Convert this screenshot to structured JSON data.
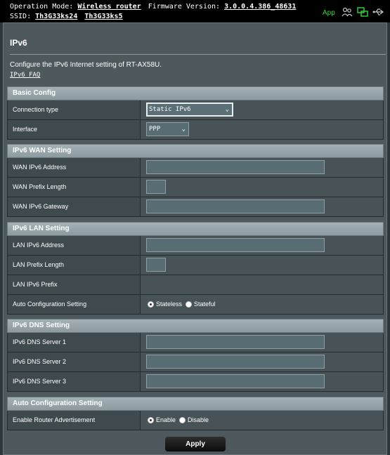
{
  "topbar": {
    "operation_mode_label": "Operation Mode:",
    "operation_mode_value": "Wireless router",
    "firmware_label": "Firmware Version:",
    "firmware_value": "3.0.0.4.386_48631",
    "ssid_label": "SSID:",
    "ssid_1": "Th3G33ks24",
    "ssid_2": "Th3G33ks5",
    "app_label": "App",
    "icons": [
      "users-icon",
      "network-status-icon",
      "usb-icon"
    ],
    "accent_color": "#33d633"
  },
  "page": {
    "title": "IPv6",
    "description": "Configure the IPv6 Internet setting of RT-AX58U.",
    "faq_link": "IPv6 FAQ"
  },
  "basic_config": {
    "header": "Basic Config",
    "connection_type_label": "Connection type",
    "connection_type_value": "Static IPv6",
    "interface_label": "Interface",
    "interface_value": "PPP"
  },
  "wan": {
    "header": "IPv6 WAN Setting",
    "address_label": "WAN IPv6 Address",
    "address_value": "",
    "prefix_length_label": "WAN Prefix Length",
    "prefix_length_value": "",
    "gateway_label": "WAN IPv6 Gateway",
    "gateway_value": ""
  },
  "lan": {
    "header": "IPv6 LAN Setting",
    "address_label": "LAN IPv6 Address",
    "address_value": "",
    "prefix_length_label": "LAN Prefix Length",
    "prefix_length_value": "",
    "prefix_label": "LAN IPv6 Prefix",
    "prefix_value": "",
    "auto_config_label": "Auto Configuration Setting",
    "auto_config_options": [
      "Stateless",
      "Stateful"
    ],
    "auto_config_selected": "Stateless"
  },
  "dns": {
    "header": "IPv6 DNS Setting",
    "server1_label": "IPv6 DNS Server 1",
    "server1_value": "",
    "server2_label": "IPv6 DNS Server 2",
    "server2_value": "",
    "server3_label": "IPv6 DNS Server 3",
    "server3_value": ""
  },
  "auto_config": {
    "header": "Auto Configuration Setting",
    "router_adv_label": "Enable Router Advertisement",
    "router_adv_options": [
      "Enable",
      "Disable"
    ],
    "router_adv_selected": "Enable"
  },
  "apply_label": "Apply"
}
